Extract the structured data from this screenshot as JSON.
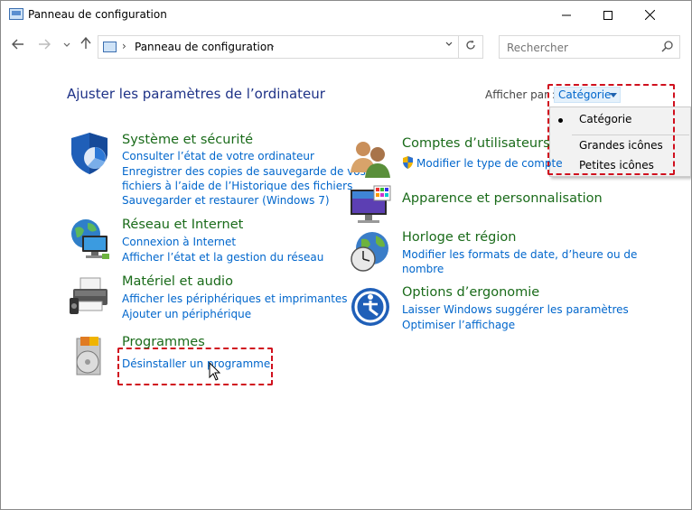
{
  "window": {
    "title": "Panneau de configuration",
    "controls": {
      "minimize": "—",
      "maximize": "☐",
      "close": "✕"
    }
  },
  "address": {
    "breadcrumb": "Panneau de configuration",
    "search_placeholder": "Rechercher"
  },
  "main": {
    "heading": "Ajuster les paramètres de l’ordinateur",
    "view_by_label": "Afficher par :",
    "view_by_value": "Catégorie",
    "view_options": [
      "Catégorie",
      "Grandes icônes",
      "Petites icônes"
    ]
  },
  "categories": {
    "system": {
      "title": "Système et sécurité",
      "links": [
        "Consulter l’état de votre ordinateur",
        "Enregistrer des copies de sauvegarde de vos",
        "fichiers à l’aide de l’Historique des fichiers",
        "Sauvegarder et restaurer (Windows 7)"
      ]
    },
    "network": {
      "title": "Réseau et Internet",
      "links": [
        "Connexion à Internet",
        "Afficher l’état et la gestion du réseau"
      ]
    },
    "hardware": {
      "title": "Matériel et audio",
      "links": [
        "Afficher les périphériques et imprimantes",
        "Ajouter un périphérique"
      ]
    },
    "programs": {
      "title": "Programmes",
      "links": [
        "Désinstaller un programme"
      ]
    },
    "users": {
      "title": "Comptes d’utilisateurs",
      "links": [
        "Modifier le type de compte"
      ]
    },
    "appearance": {
      "title": "Apparence et personnalisation",
      "links": []
    },
    "clock": {
      "title": "Horloge et région",
      "links": [
        "Modifier les formats de date, d’heure ou de",
        "nombre"
      ]
    },
    "ease": {
      "title": "Options d’ergonomie",
      "links": [
        "Laisser Windows suggérer les paramètres",
        "Optimiser l’affichage"
      ]
    }
  },
  "colors": {
    "link": "#0066cc",
    "category_title": "#1a6b1a",
    "heading": "#1e3287",
    "highlight_dash": "#d0101e"
  }
}
